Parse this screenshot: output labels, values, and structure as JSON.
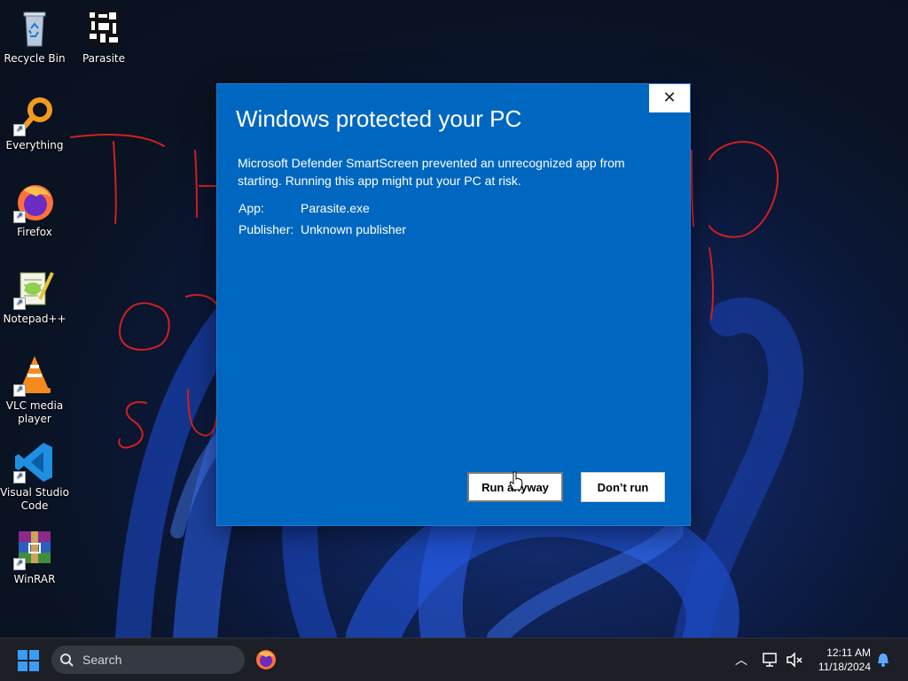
{
  "desktop": {
    "icons": [
      {
        "label": "Recycle Bin",
        "icon": "recycle-bin-icon"
      },
      {
        "label": "Parasite",
        "icon": "parasite-app-icon"
      },
      {
        "label": "Everything",
        "icon": "everything-search-icon"
      },
      {
        "label": "Firefox",
        "icon": "firefox-icon"
      },
      {
        "label": "Notepad++",
        "icon": "notepadpp-icon"
      },
      {
        "label": "VLC media player",
        "icon": "vlc-icon"
      },
      {
        "label": "Visual Studio Code",
        "icon": "vscode-icon"
      },
      {
        "label": "WinRAR",
        "icon": "winrar-icon"
      }
    ]
  },
  "dialog": {
    "title": "Windows protected your PC",
    "message": "Microsoft Defender SmartScreen prevented an unrecognized app from starting. Running this app might put your PC at risk.",
    "app_label": "App:",
    "app_value": "Parasite.exe",
    "publisher_label": "Publisher:",
    "publisher_value": "Unknown publisher",
    "run_anyway": "Run anyway",
    "dont_run": "Don’t run",
    "close_glyph": "✕",
    "bg_color": "#0067c0"
  },
  "taskbar": {
    "search_placeholder": "Search",
    "time": "12:11 AM",
    "date": "11/18/2024"
  }
}
